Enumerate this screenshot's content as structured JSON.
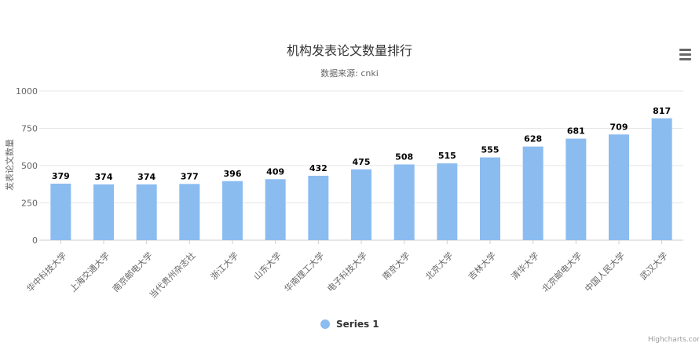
{
  "colors": {
    "bar": "#8bbcf0",
    "grid": "#e6e6e6",
    "axis": "#cfcfcf",
    "text": "#333333",
    "muted": "#666666",
    "credits": "#999999"
  },
  "credits": "Highcharts.com",
  "icons": {
    "menu": "hamburger-icon"
  },
  "chart_data": {
    "type": "bar",
    "title": "机构发表论文数量排行",
    "subtitle": "数据来源: cnki",
    "xlabel": "",
    "ylabel": "发表论文数量",
    "ylim": [
      0,
      1000
    ],
    "yticks": [
      0,
      250,
      500,
      750,
      1000
    ],
    "grid": true,
    "legend": "bottom-center",
    "categories": [
      "华中科技大学",
      "上海交通大学",
      "南京邮电大学",
      "当代贵州杂志社",
      "浙江大学",
      "山东大学",
      "华南理工大学",
      "电子科技大学",
      "南京大学",
      "北京大学",
      "吉林大学",
      "清华大学",
      "北京邮电大学",
      "中国人民大学",
      "武汉大学"
    ],
    "series": [
      {
        "name": "Series 1",
        "values": [
          379,
          374,
          374,
          377,
          396,
          409,
          432,
          475,
          508,
          515,
          555,
          628,
          681,
          709,
          817
        ]
      }
    ]
  }
}
